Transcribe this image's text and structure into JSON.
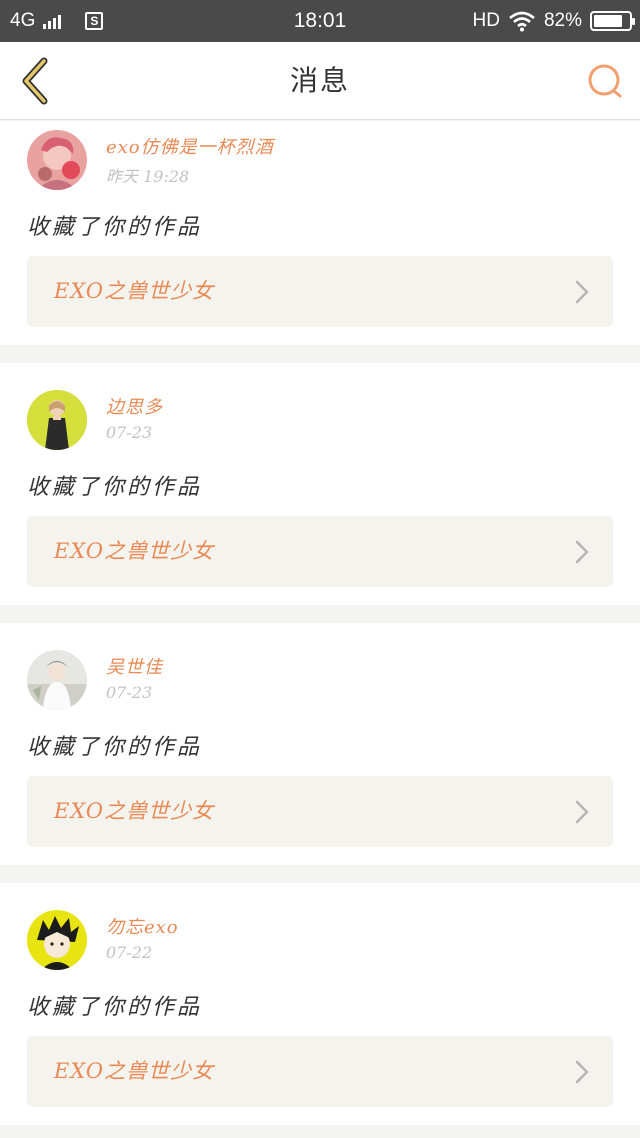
{
  "status_bar": {
    "network": "4G",
    "sim_label": "S",
    "time": "18:01",
    "hd": "HD",
    "battery": "82%"
  },
  "header": {
    "title": "消息"
  },
  "colors": {
    "accent": "#e88a55",
    "back_icon": "#c9a24a",
    "status_bar": "#4a4a4a",
    "card_box": "#f4f3ee"
  },
  "messages": [
    {
      "user": "exo仿佛是一杯烈酒",
      "time": "昨天 19:28",
      "action": "收藏了你的作品",
      "work": "EXO之兽世少女",
      "avatar_icon": "avatar-pink"
    },
    {
      "user": "边思多",
      "time": "07-23",
      "action": "收藏了你的作品",
      "work": "EXO之兽世少女",
      "avatar_icon": "avatar-yellow-girl"
    },
    {
      "user": "吴世佳",
      "time": "07-23",
      "action": "收藏了你的作品",
      "work": "EXO之兽世少女",
      "avatar_icon": "avatar-white-photo"
    },
    {
      "user": "勿忘exo",
      "time": "07-22",
      "action": "收藏了你的作品",
      "work": "EXO之兽世少女",
      "avatar_icon": "avatar-cartoon"
    }
  ]
}
